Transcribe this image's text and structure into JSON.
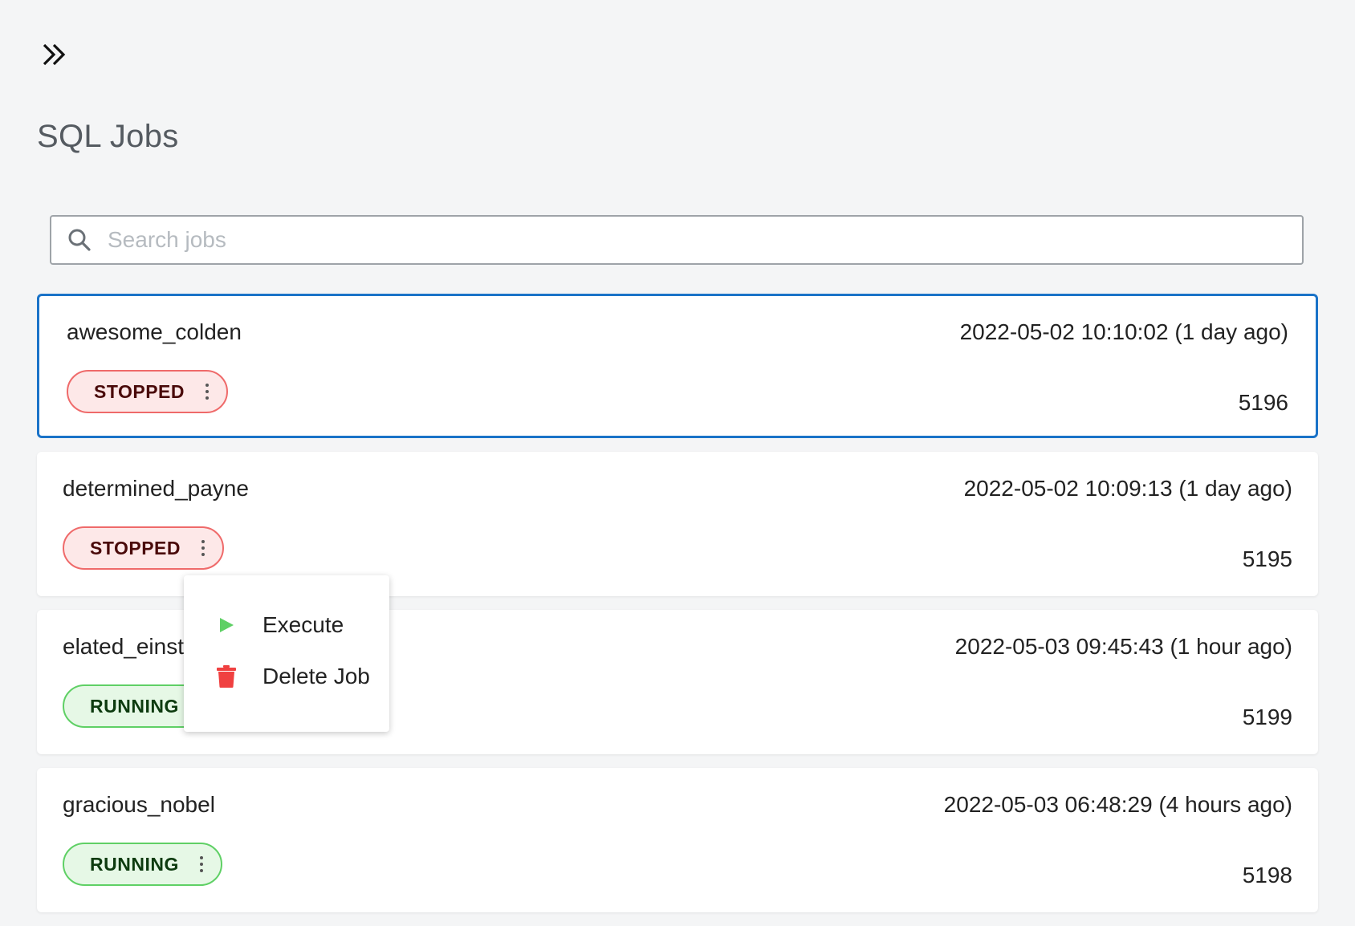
{
  "page": {
    "title": "SQL Jobs"
  },
  "search": {
    "placeholder": "Search jobs"
  },
  "jobs": [
    {
      "name": "awesome_colden",
      "timestamp": "2022-05-02 10:10:02 (1 day ago)",
      "id": "5196",
      "status": "STOPPED",
      "selected": true
    },
    {
      "name": "determined_payne",
      "timestamp": "2022-05-02 10:09:13 (1 day ago)",
      "id": "5195",
      "status": "STOPPED",
      "selected": false
    },
    {
      "name": "elated_einst",
      "timestamp": "2022-05-03 09:45:43 (1 hour ago)",
      "id": "5199",
      "status": "RUNNING",
      "selected": false
    },
    {
      "name": "gracious_nobel",
      "timestamp": "2022-05-03 06:48:29 (4 hours ago)",
      "id": "5198",
      "status": "RUNNING",
      "selected": false
    }
  ],
  "context_menu": {
    "items": [
      {
        "label": "Execute",
        "icon": "play-icon"
      },
      {
        "label": "Delete Job",
        "icon": "trash-icon"
      }
    ]
  },
  "colors": {
    "selected_border": "#1a73c8",
    "stopped_bg": "#fde8e8",
    "stopped_border": "#ef6a6a",
    "running_bg": "#e6f8e6",
    "running_border": "#5fd065",
    "execute_icon": "#5fd065",
    "delete_icon": "#f04040"
  }
}
